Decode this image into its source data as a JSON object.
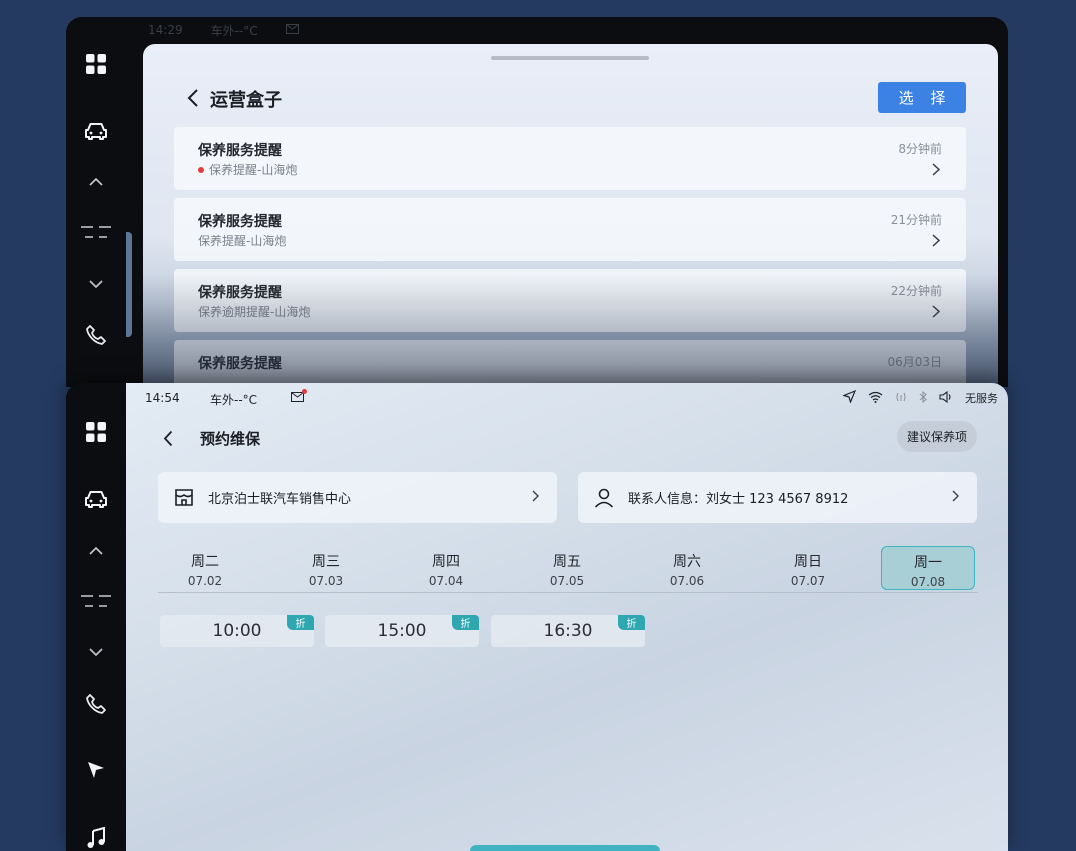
{
  "top_screen": {
    "status": {
      "time": "14:29",
      "temp": "车外--°C"
    },
    "title": "运营盒子",
    "select_label": "选 择",
    "messages": [
      {
        "title": "保养服务提醒",
        "sub": "保养提醒-山海炮",
        "time": "8分钟前",
        "unread": true
      },
      {
        "title": "保养服务提醒",
        "sub": "保养提醒-山海炮",
        "time": "21分钟前",
        "unread": false
      },
      {
        "title": "保养服务提醒",
        "sub": "保养逾期提醒-山海炮",
        "time": "22分钟前",
        "unread": false
      },
      {
        "title": "保养服务提醒",
        "sub": "",
        "time": "06月03日",
        "unread": false
      }
    ]
  },
  "bottom_screen": {
    "status": {
      "time": "14:54",
      "temp": "车外--°C",
      "service": "无服务"
    },
    "title": "预约维保",
    "suggest_label": "建议保养项",
    "dealer": "北京泊士联汽车销售中心",
    "contact": "联系人信息：刘女士  123 4567 8912",
    "days": [
      {
        "name": "周二",
        "date": "07.02",
        "selected": false
      },
      {
        "name": "周三",
        "date": "07.03",
        "selected": false
      },
      {
        "name": "周四",
        "date": "07.04",
        "selected": false
      },
      {
        "name": "周五",
        "date": "07.05",
        "selected": false
      },
      {
        "name": "周六",
        "date": "07.06",
        "selected": false
      },
      {
        "name": "周日",
        "date": "07.07",
        "selected": false
      },
      {
        "name": "周一",
        "date": "07.08",
        "selected": true
      }
    ],
    "slots": [
      {
        "time": "10:00",
        "tag": "折"
      },
      {
        "time": "15:00",
        "tag": "折"
      },
      {
        "time": "16:30",
        "tag": "折"
      }
    ]
  },
  "sidebar_icons": [
    "apps-grid-icon",
    "car-icon",
    "chevron-up-icon",
    "fan-icon",
    "chevron-down-icon",
    "phone-icon",
    "navigation-icon",
    "music-icon"
  ],
  "colors": {
    "accent": "#3b82e4",
    "teal": "#2fa7b1",
    "selected_day": "#a9cfd6",
    "unread_dot": "#e23b3b"
  }
}
